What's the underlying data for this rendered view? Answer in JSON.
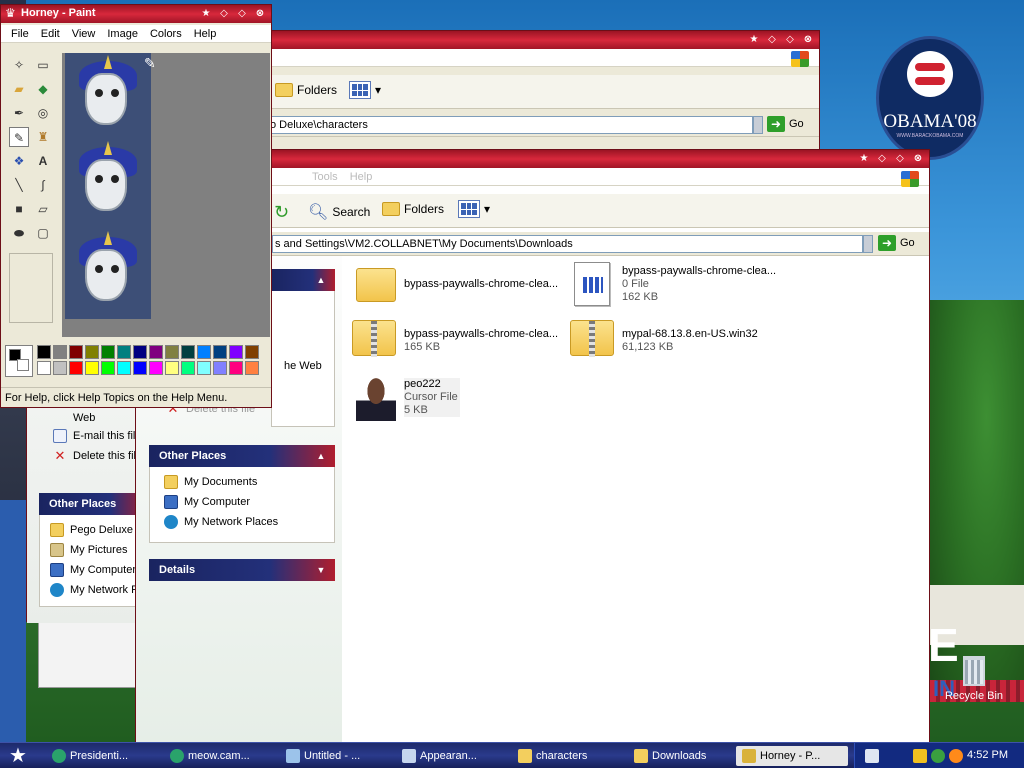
{
  "desktop": {
    "campaign_logo_text": "OBAMA'08",
    "campaign_logo_subtext": "WWW.BARACKOBAMA.COM",
    "recycle_bin_label": "Recycle Bin",
    "background_big_letter": "E",
    "background_small_text": "IN"
  },
  "explorer_back": {
    "toolbar": {
      "folders_label": "Folders"
    },
    "address": {
      "value": "o Deluxe\\characters",
      "go_label": "Go"
    },
    "file_tasks_partial": {
      "item_web": "Web",
      "email_label": "E-mail this file",
      "delete_label": "Delete this file"
    },
    "other_places": {
      "title": "Other Places",
      "items": [
        "Pego Deluxe",
        "My Pictures",
        "My Computer",
        "My Network Places"
      ]
    }
  },
  "explorer_front": {
    "toolbar": {
      "search_label": "Search",
      "folders_label": "Folders"
    },
    "menu_partial": [
      "Tools",
      "Help"
    ],
    "address": {
      "value": "s and Settings\\VM2.COLLABNET\\My Documents\\Downloads",
      "go_label": "Go"
    },
    "tasks_partial": {
      "web_label": "he Web",
      "delete_label": "Delete this file"
    },
    "other_places": {
      "title": "Other Places",
      "items": [
        "My Documents",
        "My Computer",
        "My Network Places"
      ]
    },
    "details": {
      "title": "Details"
    },
    "files": [
      {
        "name": "bypass-paywalls-chrome-clea...",
        "type": "",
        "size": ""
      },
      {
        "name": "bypass-paywalls-chrome-clea...",
        "type": "0 File",
        "size": "162 KB"
      },
      {
        "name": "bypass-paywalls-chrome-clea...",
        "type": "",
        "size": "165 KB"
      },
      {
        "name": "mypal-68.13.8.en-US.win32",
        "type": "",
        "size": "61,123 KB"
      },
      {
        "name": "peo222",
        "type": "Cursor File",
        "size": "5 KB"
      }
    ]
  },
  "paint": {
    "title": "Horney - Paint",
    "menu": [
      "File",
      "Edit",
      "View",
      "Image",
      "Colors",
      "Help"
    ],
    "status": "For Help, click Help Topics on the Help Menu.",
    "colors": {
      "row1": [
        "#000000",
        "#808080",
        "#800000",
        "#808000",
        "#008000",
        "#008080",
        "#000080",
        "#800080",
        "#808040",
        "#004040",
        "#0080ff",
        "#004080",
        "#8000ff",
        "#804000"
      ],
      "row2": [
        "#ffffff",
        "#c0c0c0",
        "#ff0000",
        "#ffff00",
        "#00ff00",
        "#00ffff",
        "#0000ff",
        "#ff00ff",
        "#ffff80",
        "#00ff80",
        "#80ffff",
        "#8080ff",
        "#ff0080",
        "#ff8040"
      ]
    }
  },
  "taskbar": {
    "items": [
      "Presidenti...",
      "meow.cam...",
      "Untitled - ...",
      "Appearan...",
      "characters",
      "Downloads",
      "Horney - P..."
    ],
    "active_item": "Horney - P...",
    "clock": "4:52 PM"
  }
}
